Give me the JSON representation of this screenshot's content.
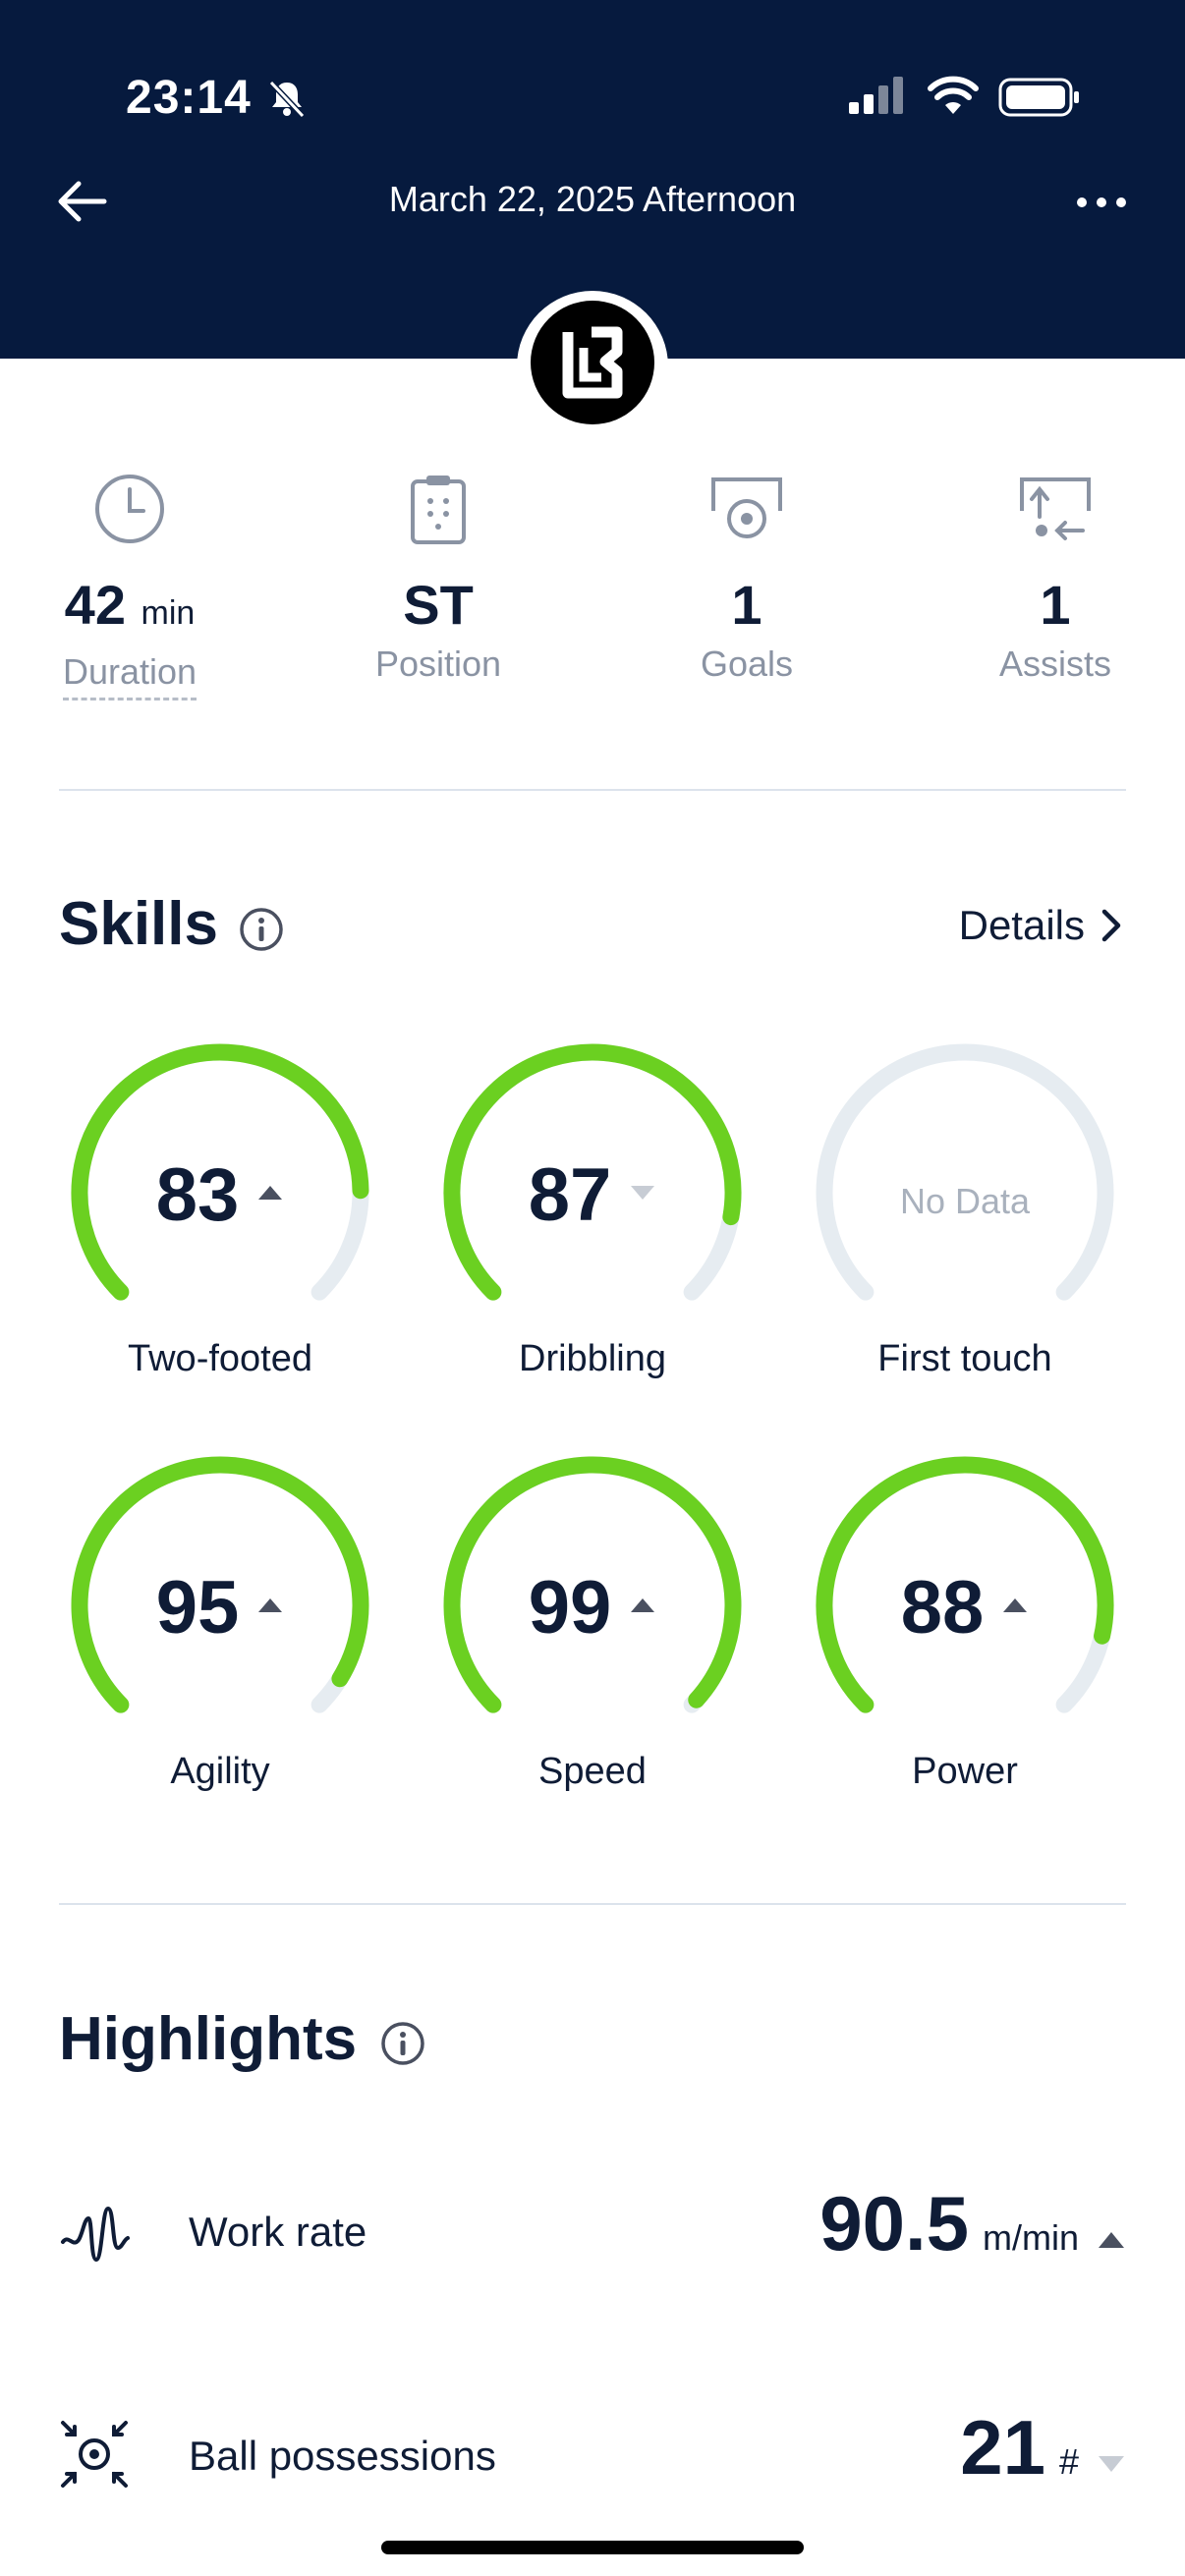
{
  "status_bar": {
    "time": "23:14"
  },
  "nav": {
    "title": "March 22, 2025 Afternoon"
  },
  "stats": [
    {
      "value": "42",
      "unit": "min",
      "label": "Duration",
      "icon": "clock-icon"
    },
    {
      "value": "ST",
      "unit": "",
      "label": "Position",
      "icon": "clipboard-icon"
    },
    {
      "value": "1",
      "unit": "",
      "label": "Goals",
      "icon": "goal-icon"
    },
    {
      "value": "1",
      "unit": "",
      "label": "Assists",
      "icon": "assist-icon"
    }
  ],
  "skills": {
    "title": "Skills",
    "details_label": "Details",
    "items": [
      {
        "label": "Two-footed",
        "value": "83",
        "level": 0.83,
        "trend": "up"
      },
      {
        "label": "Dribbling",
        "value": "87",
        "level": 0.87,
        "trend": "down"
      },
      {
        "label": "First touch",
        "value": "No Data",
        "level": 0,
        "trend": "none"
      },
      {
        "label": "Agility",
        "value": "95",
        "level": 0.95,
        "trend": "up"
      },
      {
        "label": "Speed",
        "value": "99",
        "level": 0.99,
        "trend": "up"
      },
      {
        "label": "Power",
        "value": "88",
        "level": 0.88,
        "trend": "up"
      }
    ]
  },
  "highlights": {
    "title": "Highlights",
    "items": [
      {
        "label": "Work rate",
        "value": "90.5",
        "unit": "m/min",
        "trend": "up",
        "icon": "work-rate-icon"
      },
      {
        "label": "Ball possessions",
        "value": "21",
        "unit": "#",
        "trend": "down",
        "icon": "ball-possession-icon"
      }
    ]
  },
  "colors": {
    "header_bg": "#061a3e",
    "gauge_fill": "#6bd021",
    "gauge_track": "#e6ecf1",
    "text_dark": "#0f1c36",
    "text_muted": "#8a93a3",
    "trend_up": "#4a5060",
    "trend_down": "#c7ccd4"
  }
}
